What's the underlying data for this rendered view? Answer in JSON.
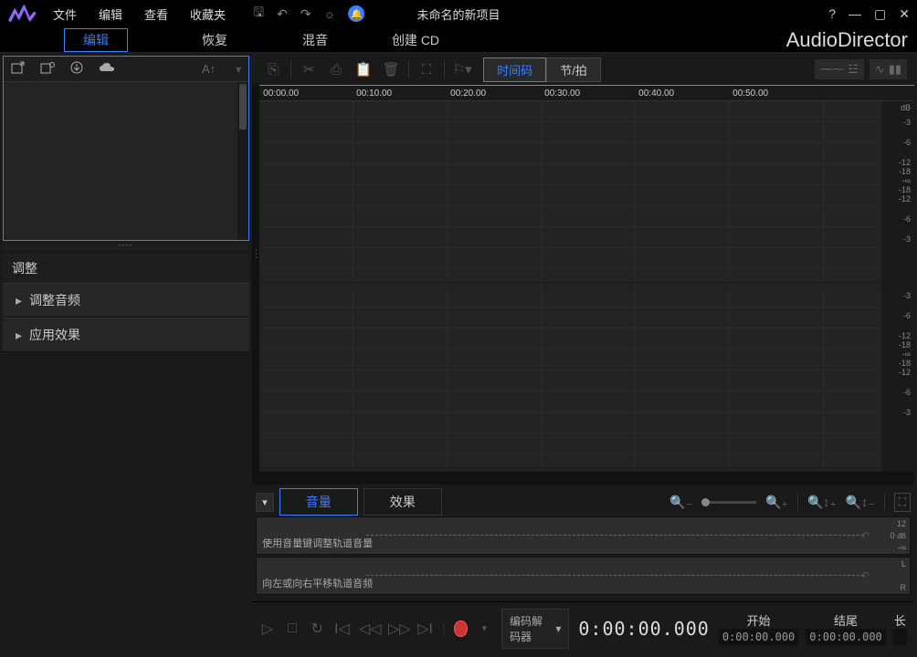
{
  "title": "未命名的新项目",
  "brand": "AudioDirector",
  "menu": [
    "文件",
    "编辑",
    "查看",
    "收藏夹"
  ],
  "mainTabs": {
    "edit": "编辑",
    "restore": "恢复",
    "mix": "混音",
    "cd": "创建 CD"
  },
  "mediabar": {
    "aa": "A↑"
  },
  "adjust": {
    "title": "调整",
    "items": [
      "调整音频",
      "应用效果"
    ]
  },
  "toggle": {
    "timecode": "时间码",
    "beat": "节/拍"
  },
  "ruler": {
    "t0": "00:00.00",
    "t1": "00:10.00",
    "t2": "00:20.00",
    "t3": "00:30.00",
    "t4": "00:40.00",
    "t5": "00:50.00"
  },
  "db": {
    "unit": "dB",
    "v": [
      "-3",
      "-6",
      "-12",
      "-18",
      "-∞",
      "-18",
      "-12",
      "-6",
      "-3"
    ]
  },
  "midtabs": {
    "volume": "音量",
    "effects": "效果"
  },
  "env1": {
    "label": "使用音量键调整轨道音量",
    "scale": [
      "12",
      "0",
      "-∞"
    ],
    "unit": "dB"
  },
  "env2": {
    "label": "向左或向右平移轨道音频",
    "l": "L",
    "r": "R"
  },
  "transport": {
    "decoder": "编码解码器",
    "time": "0:00:00.000",
    "start_lbl": "开始",
    "start": "0:00:00.000",
    "end_lbl": "结尾",
    "end": "0:00:00.000",
    "len_lbl": "长"
  }
}
